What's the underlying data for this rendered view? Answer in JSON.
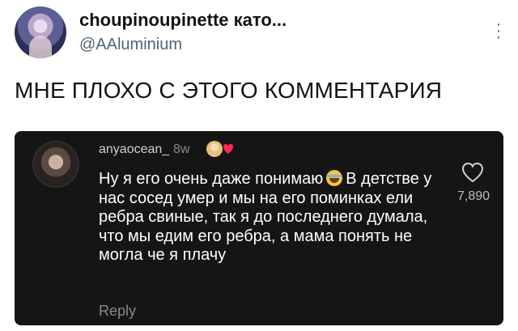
{
  "tweet": {
    "display_name": "choupinoupinette като...",
    "handle": "@AAluminium",
    "text": "МНЕ ПЛОХО С ЭТОГО КОММЕНТАРИЯ",
    "avatar_icon": "avatar",
    "more_icon": "more-vertical-icon"
  },
  "comment": {
    "username": "anyaocean_",
    "time": "8w",
    "text_before_emoji": "Ну я его очень даже понимаю",
    "emoji": "laughing-emoji",
    "text_after_emoji": "В детстве у нас сосед умер и мы на его поминках ели ребра свиные, так я до последнего думала, что мы едим его ребра, а мама понять не могла че я плачу",
    "reply_label": "Reply",
    "likes": "7,890",
    "heart_icon": "heart-icon",
    "badge_icon": "liked-by-author-badge"
  },
  "colors": {
    "card_bg": "#151515",
    "secondary_text": "#536471",
    "comment_text": "#ffffff",
    "muted": "#8a8a8a"
  }
}
